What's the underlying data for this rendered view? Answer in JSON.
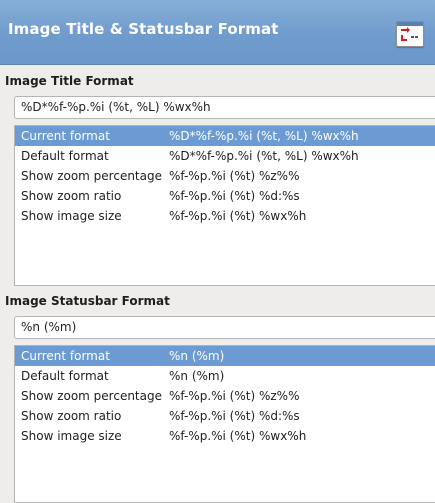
{
  "header": {
    "title": "Image Title & Statusbar Format"
  },
  "title_section": {
    "label": "Image Title Format",
    "value": "%D*%f-%p.%i (%t, %L) %wx%h",
    "presets": [
      {
        "name": "Current format",
        "format": "%D*%f-%p.%i (%t, %L) %wx%h",
        "selected": true
      },
      {
        "name": "Default format",
        "format": "%D*%f-%p.%i (%t, %L) %wx%h",
        "selected": false
      },
      {
        "name": "Show zoom percentage",
        "format": "%f-%p.%i (%t) %z%%",
        "selected": false
      },
      {
        "name": "Show zoom ratio",
        "format": "%f-%p.%i (%t) %d:%s",
        "selected": false
      },
      {
        "name": "Show image size",
        "format": "%f-%p.%i (%t) %wx%h",
        "selected": false
      }
    ]
  },
  "statusbar_section": {
    "label": "Image Statusbar Format",
    "value": "%n (%m)",
    "presets": [
      {
        "name": "Current format",
        "format": "%n (%m)",
        "selected": true
      },
      {
        "name": "Default format",
        "format": "%n (%m)",
        "selected": false
      },
      {
        "name": "Show zoom percentage",
        "format": "%f-%p.%i (%t) %z%%",
        "selected": false
      },
      {
        "name": "Show zoom ratio",
        "format": "%f-%p.%i (%t) %d:%s",
        "selected": false
      },
      {
        "name": "Show image size",
        "format": "%f-%p.%i (%t) %wx%h",
        "selected": false
      }
    ]
  },
  "colors": {
    "header_bg": "#6f9bcd",
    "selection": "#6b9bd2",
    "dialog_bg": "#eeedeb"
  },
  "icons": {
    "header": "image-title-format-icon"
  }
}
